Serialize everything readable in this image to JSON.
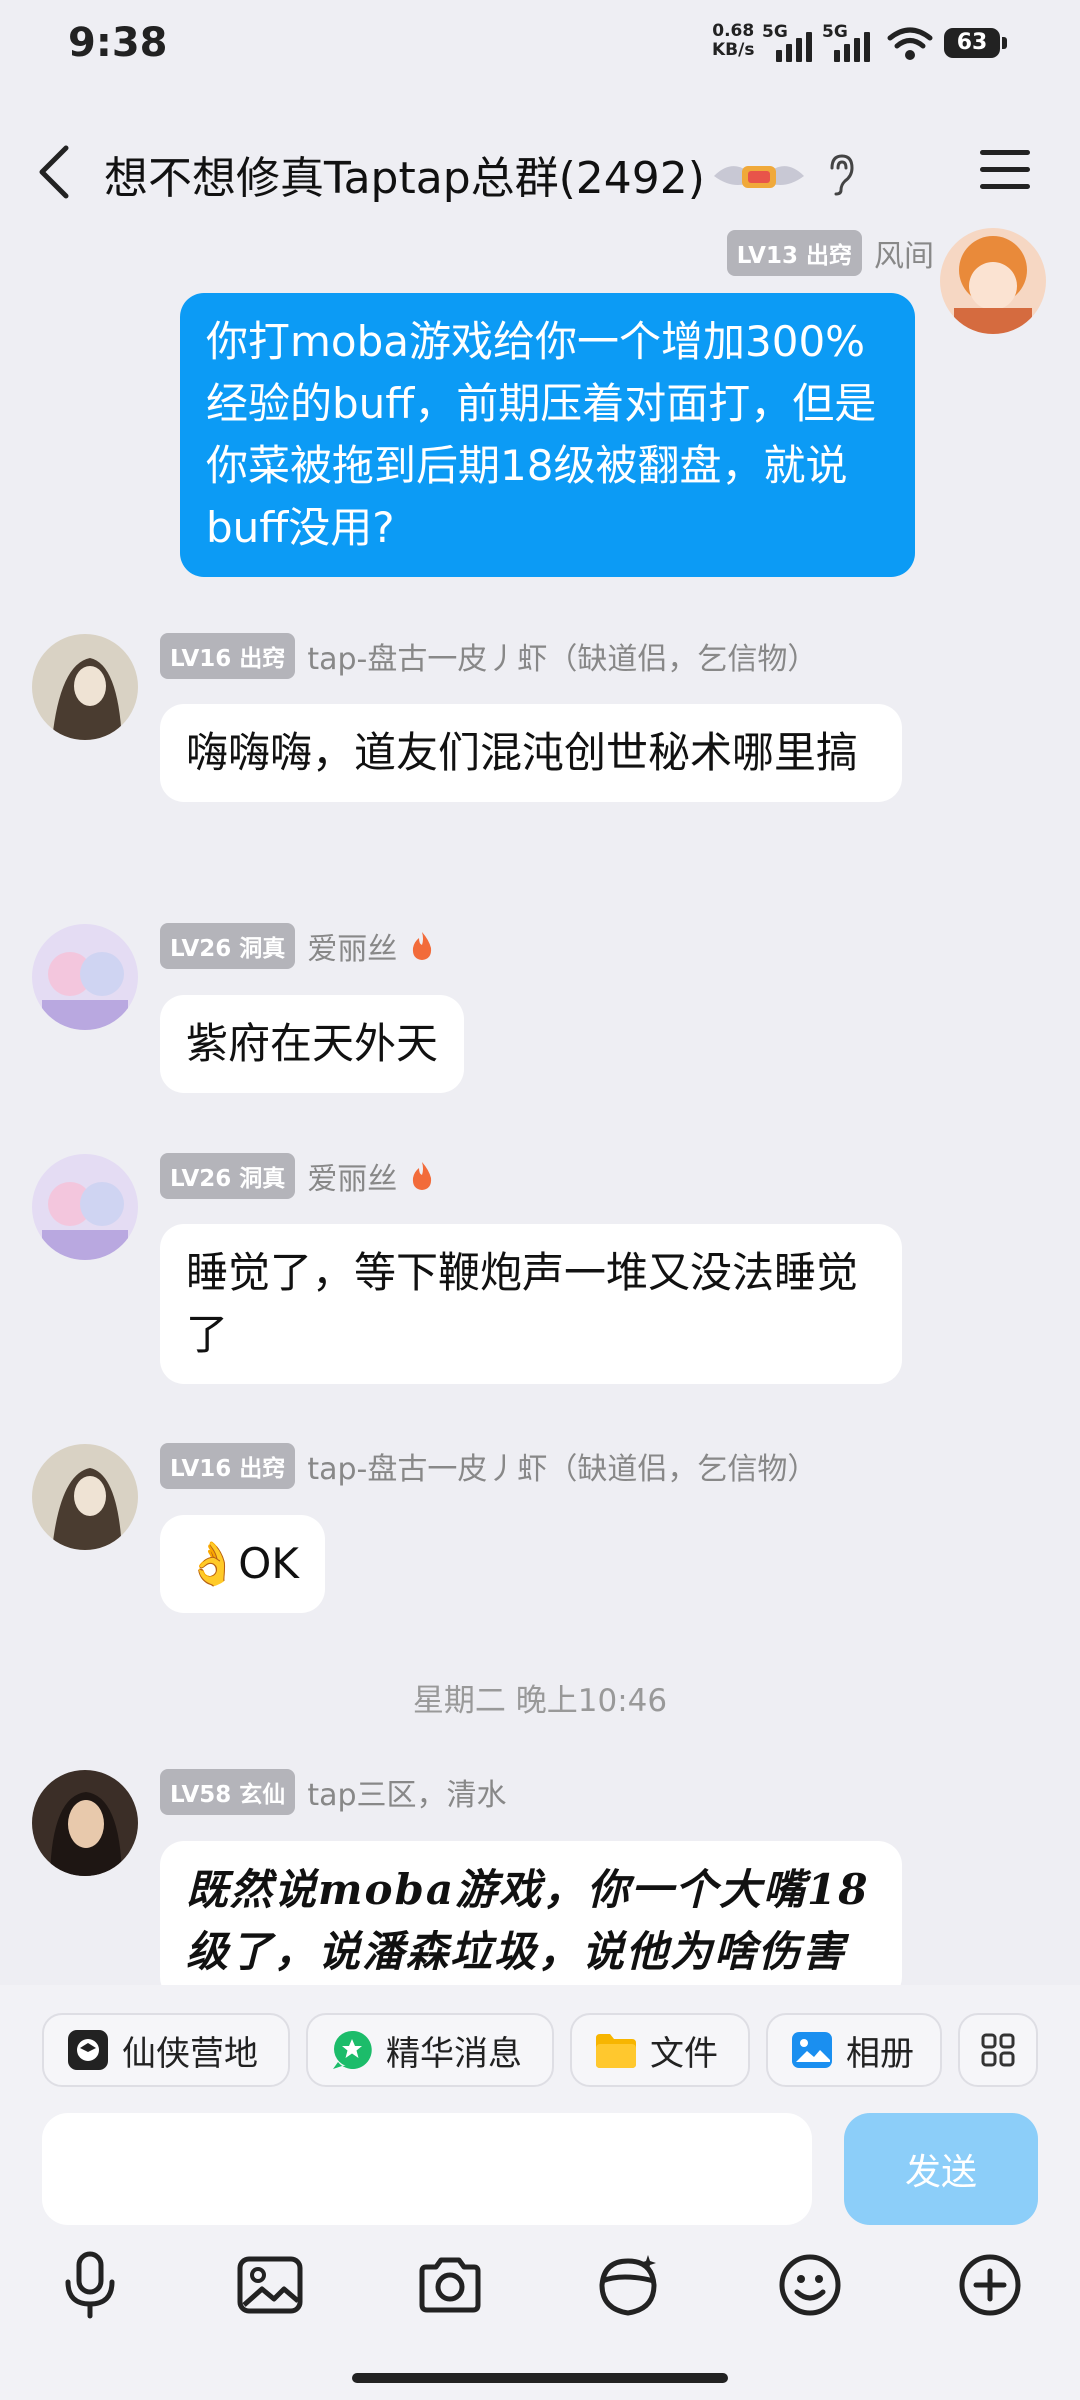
{
  "status_bar": {
    "time": "9:38",
    "net_speed_value": "0.68",
    "net_speed_unit": "KB/s",
    "sim1": "5G",
    "sim2": "5G",
    "battery": "63"
  },
  "header": {
    "title": "想不想修真Taptap总群(2492)"
  },
  "messages": [
    {
      "sender": "风间",
      "level": "LV13 出窍",
      "text": "你打moba游戏给你一个增加300%经验的buff，前期压着对面打，但是你菜被拖到后期18级被翻盘，就说buff没用?"
    },
    {
      "sender": "tap-盘古一皮丿虾（缺道侣，乞信物）",
      "level": "LV16 出窍",
      "text": "嗨嗨嗨，道友们混沌创世秘术哪里搞"
    },
    {
      "sender": "爱丽丝",
      "level": "LV26 洞真",
      "text": "紫府在天外天"
    },
    {
      "sender": "爱丽丝",
      "level": "LV26 洞真",
      "text": "睡觉了，等下鞭炮声一堆又没法睡觉了"
    },
    {
      "sender": "tap-盘古一皮丿虾（缺道侣，乞信物）",
      "level": "LV16 出窍",
      "text": "👌OK"
    },
    {
      "sender": "tap三区，清水",
      "level": "LV58 玄仙",
      "text": "既然说moba游戏，你一个大嘴18级了，说潘森垃圾，说他为啥伤害"
    }
  ],
  "time_divider": "星期二 晚上10:46",
  "quick_actions": [
    {
      "label": "仙侠营地",
      "icon": "camp-icon"
    },
    {
      "label": "精华消息",
      "icon": "star-icon"
    },
    {
      "label": "文件",
      "icon": "folder-icon"
    },
    {
      "label": "相册",
      "icon": "album-icon"
    }
  ],
  "input": {
    "value": "",
    "send_label": "发送"
  },
  "colors": {
    "accent": "#0c9bf5",
    "send_disabled": "#8ccef9",
    "background": "#eeeef3",
    "fire": "#f26b3a"
  }
}
